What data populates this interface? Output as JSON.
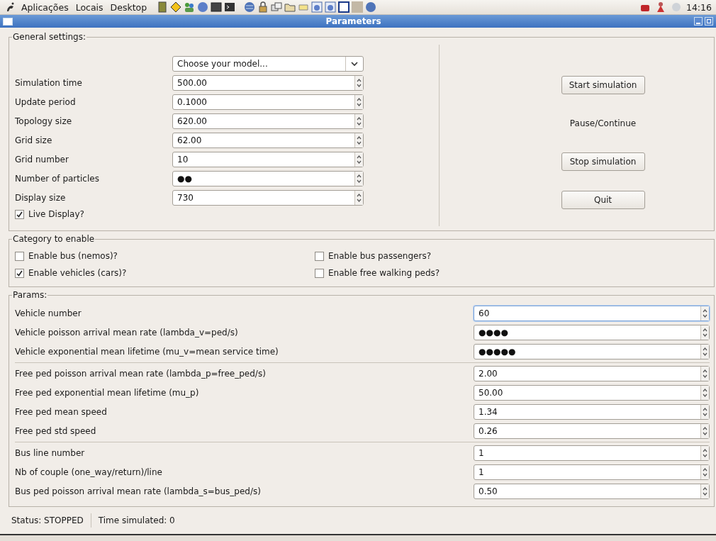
{
  "top_panel": {
    "menus": [
      "Aplicações",
      "Locais",
      "Desktop"
    ],
    "clock": "14:16"
  },
  "window": {
    "title": "Parameters"
  },
  "general": {
    "title": "General settings:",
    "model_combo": {
      "value": "Choose your model..."
    },
    "fields": [
      {
        "label": "Simulation time",
        "value": "500.00"
      },
      {
        "label": "Update period",
        "value": "0.1000"
      },
      {
        "label": "Topology size",
        "value": "620.00"
      },
      {
        "label": "Grid size",
        "value": "62.00"
      },
      {
        "label": "Grid number",
        "value": "10"
      },
      {
        "label": "Number of particles",
        "value": "●●"
      },
      {
        "label": "Display size",
        "value": "730"
      }
    ],
    "live_display": {
      "label": "Live Display?",
      "checked": true
    },
    "buttons": [
      {
        "label": "Start simulation",
        "flat": false
      },
      {
        "label": "Pause/Continue",
        "flat": true
      },
      {
        "label": "Stop simulation",
        "flat": false
      },
      {
        "label": "Quit",
        "flat": false
      }
    ]
  },
  "category": {
    "title": "Category to enable",
    "options": [
      {
        "label": "Enable bus (nemos)?",
        "checked": false
      },
      {
        "label": "Enable bus passengers?",
        "checked": false
      },
      {
        "label": "Enable vehicles (cars)?",
        "checked": true
      },
      {
        "label": "Enable free walking peds?",
        "checked": false
      }
    ]
  },
  "params": {
    "title": "Params:",
    "groups": [
      [
        {
          "label": "Vehicle number",
          "value": "60",
          "focused": true
        },
        {
          "label": "Vehicle poisson arrival mean rate (lambda_v=ped/s)",
          "value": "●●●●",
          "focused": false
        },
        {
          "label": "Vehicle exponential mean lifetime (mu_v=mean service time)",
          "value": "●●●●●",
          "focused": false
        }
      ],
      [
        {
          "label": "Free ped poisson arrival mean rate (lambda_p=free_ped/s)",
          "value": "2.00",
          "focused": false
        },
        {
          "label": "Free ped exponential mean lifetime (mu_p)",
          "value": "50.00",
          "focused": false
        },
        {
          "label": "Free ped mean speed",
          "value": "1.34",
          "focused": false
        },
        {
          "label": "Free ped std speed",
          "value": "0.26",
          "focused": false
        }
      ],
      [
        {
          "label": "Bus line number",
          "value": "1",
          "focused": false
        },
        {
          "label": "Nb of couple (one_way/return)/line",
          "value": "1",
          "focused": false
        },
        {
          "label": "Bus ped poisson arrival mean rate (lambda_s=bus_ped/s)",
          "value": "0.50",
          "focused": false
        }
      ]
    ]
  },
  "status_bar": [
    "Status: STOPPED",
    "Time simulated: 0"
  ]
}
